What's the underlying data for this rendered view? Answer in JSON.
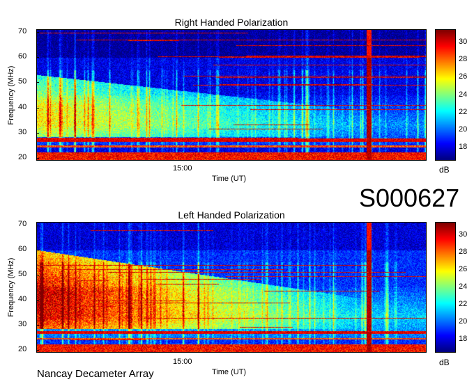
{
  "observation_id": "S000627",
  "footer": "Nancay Decameter Array",
  "chart_data": [
    {
      "type": "heatmap",
      "title": "Right Handed Polarization",
      "xlabel": "Time (UT)",
      "ylabel": "Frequency (MHz)",
      "x_ticks": [
        "15:00"
      ],
      "y_ticks": [
        20,
        30,
        40,
        50,
        60,
        70
      ],
      "ylim": [
        19,
        71
      ],
      "colorbar": {
        "label": "dB",
        "ticks": [
          18,
          20,
          22,
          24,
          26,
          28,
          30
        ],
        "range": [
          16.5,
          31.5
        ]
      },
      "colormap": "jet",
      "features": {
        "left_enhancement_peak_db": 25,
        "left_enhancement_top_mhz": 53,
        "low_freq_band_db": 31,
        "background_db": 18
      }
    },
    {
      "type": "heatmap",
      "title": "Left Handed Polarization",
      "xlabel": "Time (UT)",
      "ylabel": "Frequency (MHz)",
      "x_ticks": [
        "15:00"
      ],
      "y_ticks": [
        20,
        30,
        40,
        50,
        60,
        70
      ],
      "ylim": [
        19,
        71
      ],
      "colorbar": {
        "label": "dB",
        "ticks": [
          18,
          20,
          22,
          24,
          26,
          28,
          30
        ],
        "range": [
          16.5,
          31.5
        ]
      },
      "colormap": "jet",
      "features": {
        "left_enhancement_peak_db": 30.5,
        "left_enhancement_top_mhz": 60,
        "low_freq_band_db": 31,
        "background_db": 19
      }
    }
  ]
}
